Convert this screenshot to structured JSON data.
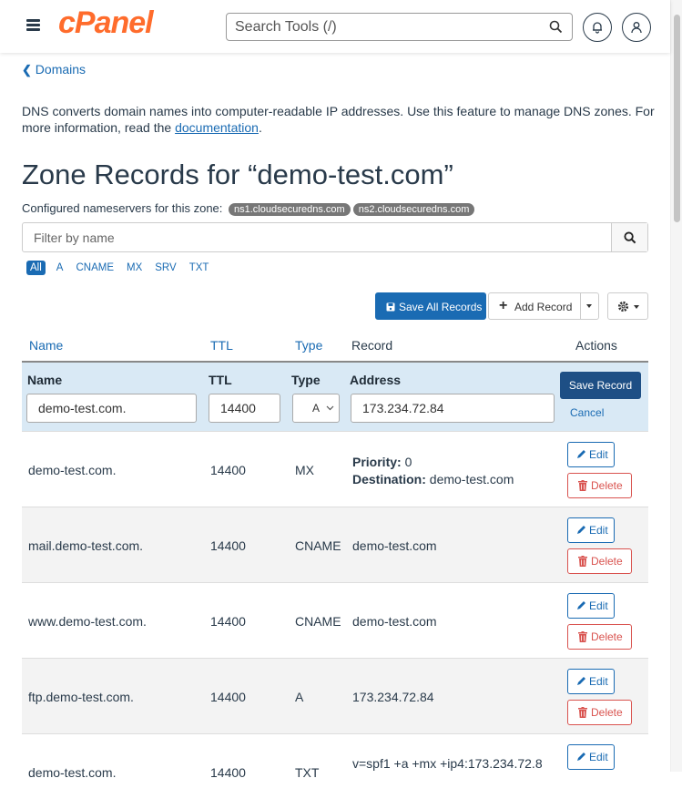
{
  "header": {
    "logo": "cPanel",
    "search_placeholder": "Search Tools (/)"
  },
  "breadcrumb": {
    "back_label": "Domains"
  },
  "intro": {
    "text": "DNS converts domain names into computer-readable IP addresses. Use this feature to manage DNS zones. For more information, read the ",
    "link": "documentation",
    "end": "."
  },
  "page_title": "Zone Records for “demo-test.com”",
  "nameservers": {
    "label": "Configured nameservers for this zone:",
    "items": [
      "ns1.cloudsecuredns.com",
      "ns2.cloudsecuredns.com"
    ]
  },
  "filter": {
    "placeholder": "Filter by name"
  },
  "type_filters": [
    "All",
    "A",
    "CNAME",
    "MX",
    "SRV",
    "TXT"
  ],
  "toolbar": {
    "save_all": "Save All Records",
    "add_record": "Add Record"
  },
  "table": {
    "headers": {
      "name": "Name",
      "ttl": "TTL",
      "type": "Type",
      "record": "Record",
      "actions": "Actions"
    },
    "edit_row": {
      "labels": {
        "name": "Name",
        "ttl": "TTL",
        "type": "Type",
        "address": "Address"
      },
      "name": "demo-test.com.",
      "ttl": "14400",
      "type": "A",
      "address": "173.234.72.84",
      "save": "Save Record",
      "cancel": "Cancel"
    },
    "rows": [
      {
        "name": "demo-test.com.",
        "ttl": "14400",
        "type": "MX",
        "priority_label": "Priority:",
        "priority": "0",
        "destination_label": "Destination:",
        "destination": "demo-test.com"
      },
      {
        "name": "mail.demo-test.com.",
        "ttl": "14400",
        "type": "CNAME",
        "record": "demo-test.com"
      },
      {
        "name": "www.demo-test.com.",
        "ttl": "14400",
        "type": "CNAME",
        "record": "demo-test.com"
      },
      {
        "name": "ftp.demo-test.com.",
        "ttl": "14400",
        "type": "A",
        "record": "173.234.72.84"
      },
      {
        "name": "demo-test.com.",
        "ttl": "14400",
        "type": "TXT",
        "record": "v=spf1 +a +mx +ip4:173.234.72.8"
      }
    ],
    "edit_label": "Edit",
    "delete_label": "Delete"
  }
}
